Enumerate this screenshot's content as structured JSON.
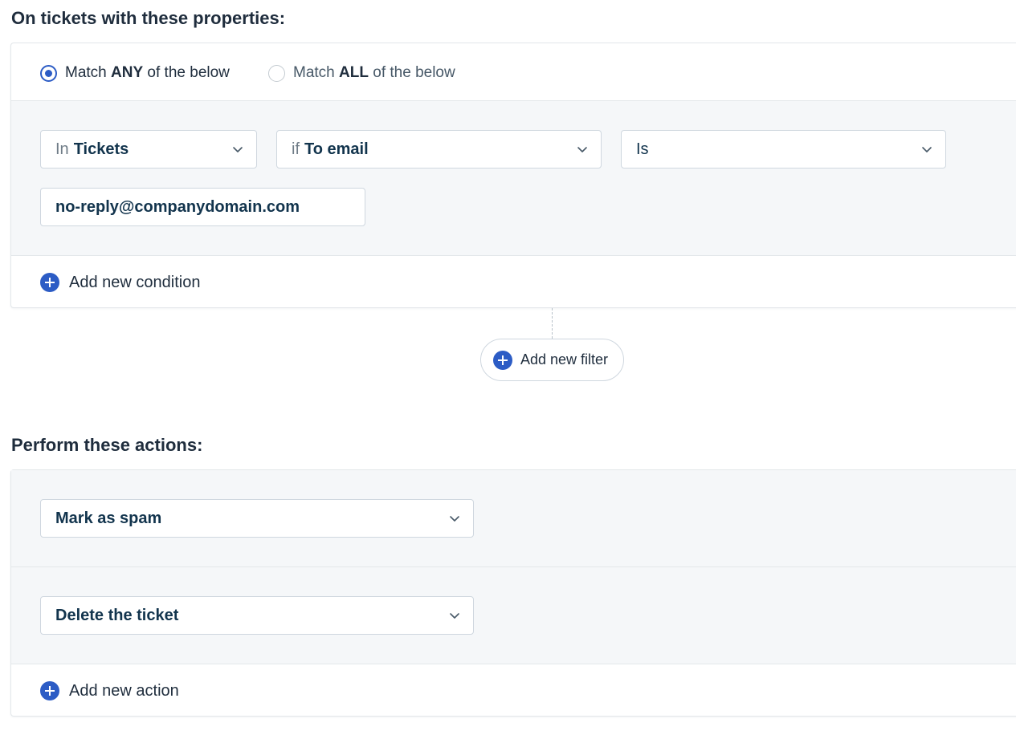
{
  "conditions_section": {
    "title": "On tickets with these properties:",
    "match_any": {
      "prefix": "Match ",
      "bold": "ANY",
      "suffix": " of the below",
      "selected": true
    },
    "match_all": {
      "prefix": "Match ",
      "bold": "ALL",
      "suffix": " of the below",
      "selected": false
    },
    "condition": {
      "scope_prefix": "In",
      "scope_value": "Tickets",
      "field_prefix": "if",
      "field_value": "To email",
      "operator_value": "Is",
      "input_value": "no-reply@companydomain.com"
    },
    "add_condition_label": "Add new condition",
    "add_filter_label": "Add new filter"
  },
  "actions_section": {
    "title": "Perform these actions:",
    "actions": [
      {
        "value": "Mark as spam"
      },
      {
        "value": "Delete the ticket"
      }
    ],
    "add_action_label": "Add new action"
  },
  "icons": {
    "chevron": "chevron-down-icon",
    "plus": "plus-circle-icon"
  },
  "colors": {
    "accent": "#2c5cc5",
    "panel_bg": "#f5f7f9",
    "border": "#cfd7df",
    "text": "#12344d"
  }
}
